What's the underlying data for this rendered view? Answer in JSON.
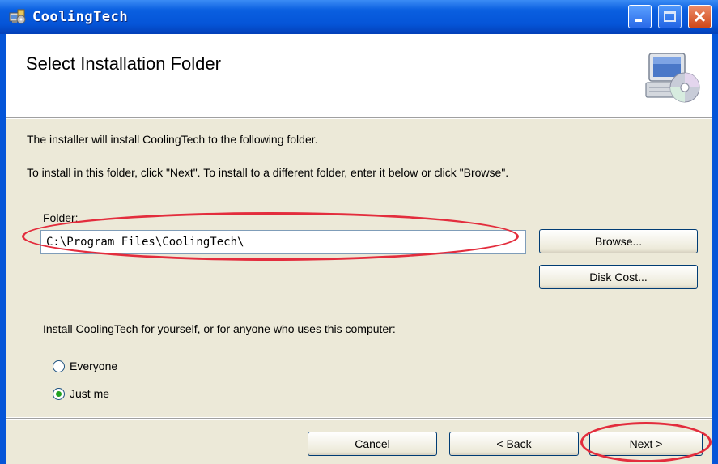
{
  "window": {
    "title": "CoolingTech",
    "controls": [
      "minimize-icon",
      "maximize-icon",
      "close-icon"
    ]
  },
  "header": {
    "title": "Select Installation Folder",
    "icon": "computer-cd-icon"
  },
  "body": {
    "intro": "The installer will install CoolingTech to the following folder.",
    "instructions": "To install in this folder, click \"Next\". To install to a different folder, enter it below or click \"Browse\".",
    "folder_label": "Folder:",
    "folder_value": "C:\\Program Files\\CoolingTech\\",
    "browse_label": "Browse...",
    "disk_cost_label": "Disk Cost...",
    "install_for_prompt": "Install CoolingTech for yourself, or for anyone who uses this computer:",
    "options": [
      {
        "label": "Everyone",
        "selected": false
      },
      {
        "label": "Just me",
        "selected": true
      }
    ]
  },
  "footer": {
    "cancel_label": "Cancel",
    "back_label": "< Back",
    "next_label": "Next >"
  },
  "colors": {
    "titlebar": "#0555d8",
    "dialog_bg": "#ece9d8",
    "annotation": "#e32d3d"
  }
}
